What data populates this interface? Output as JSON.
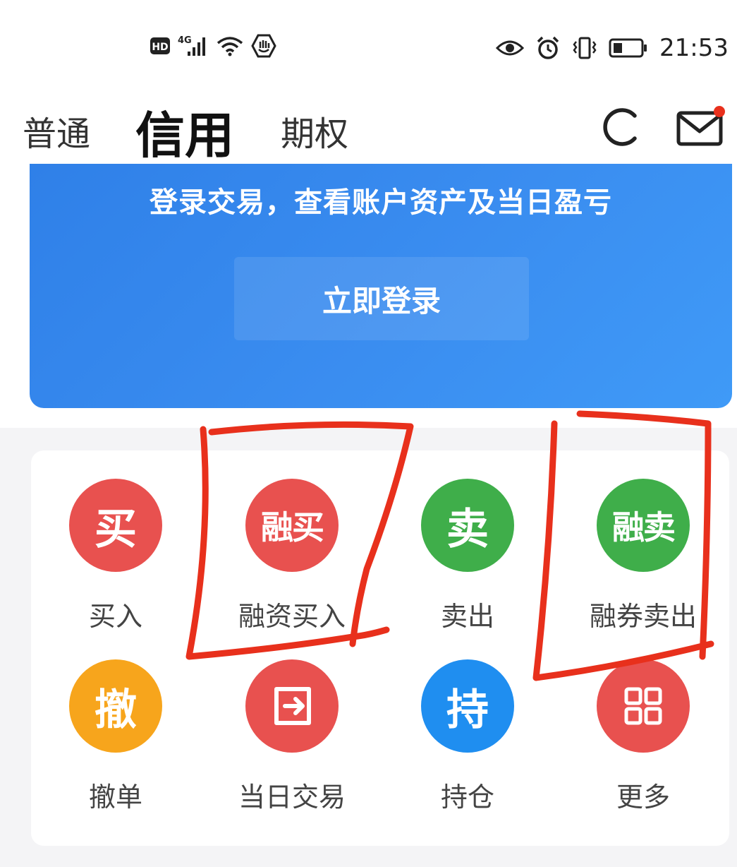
{
  "status_bar": {
    "left_icons": [
      "hd-icon",
      "signal-4g-icon",
      "wifi-icon",
      "shield-hand-icon"
    ],
    "hd_label": "HD",
    "network_label": "4G",
    "right_icons": [
      "eye-icon",
      "alarm-icon",
      "vibrate-icon",
      "battery-icon"
    ],
    "time": "21:53"
  },
  "tabs": {
    "normal": "普通",
    "credit": "信用",
    "option": "期权"
  },
  "banner": {
    "text": "登录交易，查看账户资产及当日盈亏",
    "login_label": "立即登录"
  },
  "colors": {
    "red": "#e8514f",
    "green": "#3fae4a",
    "orange": "#f7a51c",
    "blue": "#1f8ef0",
    "banner_blue": "#3a8df0",
    "annotation_red": "#e8301c"
  },
  "grid": {
    "items": [
      {
        "icon_text": "买",
        "label": "买入",
        "color": "#e8514f"
      },
      {
        "icon_text": "融买",
        "label": "融资买入",
        "color": "#e8514f"
      },
      {
        "icon_text": "卖",
        "label": "卖出",
        "color": "#3fae4a"
      },
      {
        "icon_text": "融卖",
        "label": "融券卖出",
        "color": "#3fae4a"
      },
      {
        "icon_text": "撤",
        "label": "撤单",
        "color": "#f7a51c"
      },
      {
        "icon_text": "",
        "icon": "exit-box-icon",
        "label": "当日交易",
        "color": "#e8514f"
      },
      {
        "icon_text": "持",
        "label": "持仓",
        "color": "#1f8ef0"
      },
      {
        "icon_text": "",
        "icon": "grid-apps-icon",
        "label": "更多",
        "color": "#e8514f"
      }
    ]
  }
}
